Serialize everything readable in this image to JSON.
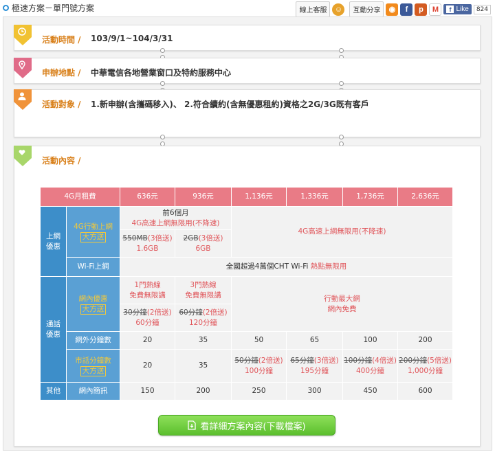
{
  "header": {
    "breadcrumb": "極速方案－單門號方案",
    "service_label": "線上客服",
    "share_label": "互動分享",
    "like_label": "Like",
    "like_count": "824"
  },
  "sections": [
    {
      "title": "活動時間 /",
      "value": "103/9/1~104/3/31",
      "color": "#f1c232"
    },
    {
      "title": "申辦地點 /",
      "value": "中華電信各地營業窗口及特約服務中心",
      "color": "#e06b88"
    },
    {
      "title": "活動對象 /",
      "value": "1.新申辦(含攜碼移入)、 2.符合續約(含無優惠租約)資格之2G/3G既有客戶",
      "color": "#f0933a"
    },
    {
      "title": "活動內容 /",
      "value": "",
      "color": "#a8d66a"
    }
  ],
  "table": {
    "head": [
      "4G月租費",
      "636元",
      "936元",
      "1,136元",
      "1,336元",
      "1,736元",
      "2,636元"
    ],
    "cat_data": "上網\n優惠",
    "cat_call": "通話\n優惠",
    "cat_other": "其他",
    "lbl_4g": "4G行動上網",
    "lbl_promo": "大方送",
    "first6_a": "前6個月",
    "first6_b": "4G高速上網無限用(不降速)",
    "unlimited_4g": "4G高速上網無限用(不降速)",
    "d636_strike": "550MB",
    "d636_mult": "(3倍送)",
    "d636_val": "1.6GB",
    "d936_strike": "2GB",
    "d936_mult": "(3倍送)",
    "d936_val": "6GB",
    "lbl_wifi": "Wi-Fi上網",
    "wifi_a": "全國超過4萬個CHT Wi-Fi ",
    "wifi_b": "熱點無限用",
    "lbl_onnet": "網內優惠",
    "on636_a": "1門熱線",
    "on636_b": "免費無限講",
    "on936_a": "3門熱線",
    "on936_b": "免費無限講",
    "on_big_a": "行動最大網",
    "on_big_b": "網內免費",
    "on636_strike": "30分鐘",
    "on636_mult": "(2倍送)",
    "on636_val": "60分鐘",
    "on936_strike": "60分鐘",
    "on936_mult": "(2倍送)",
    "on936_val": "120分鐘",
    "lbl_offnet": "網外分鐘數",
    "offnet": [
      "20",
      "35",
      "50",
      "65",
      "100",
      "200"
    ],
    "lbl_local": "市話分鐘數",
    "local_plain": [
      "20",
      "35"
    ],
    "local_promo": [
      {
        "strike": "50分鐘",
        "mult": "(2倍送)",
        "val": "100分鐘"
      },
      {
        "strike": "65分鐘",
        "mult": "(3倍送)",
        "val": "195分鐘"
      },
      {
        "strike": "100分鐘",
        "mult": "(4倍送)",
        "val": "400分鐘"
      },
      {
        "strike": "200分鐘",
        "mult": "(5倍送)",
        "val": "1,000分鐘"
      }
    ],
    "lbl_sms": "網內簡訊",
    "sms": [
      "150",
      "200",
      "250",
      "300",
      "450",
      "600"
    ]
  },
  "download_label": "看詳細方案內容(下載檔案)"
}
